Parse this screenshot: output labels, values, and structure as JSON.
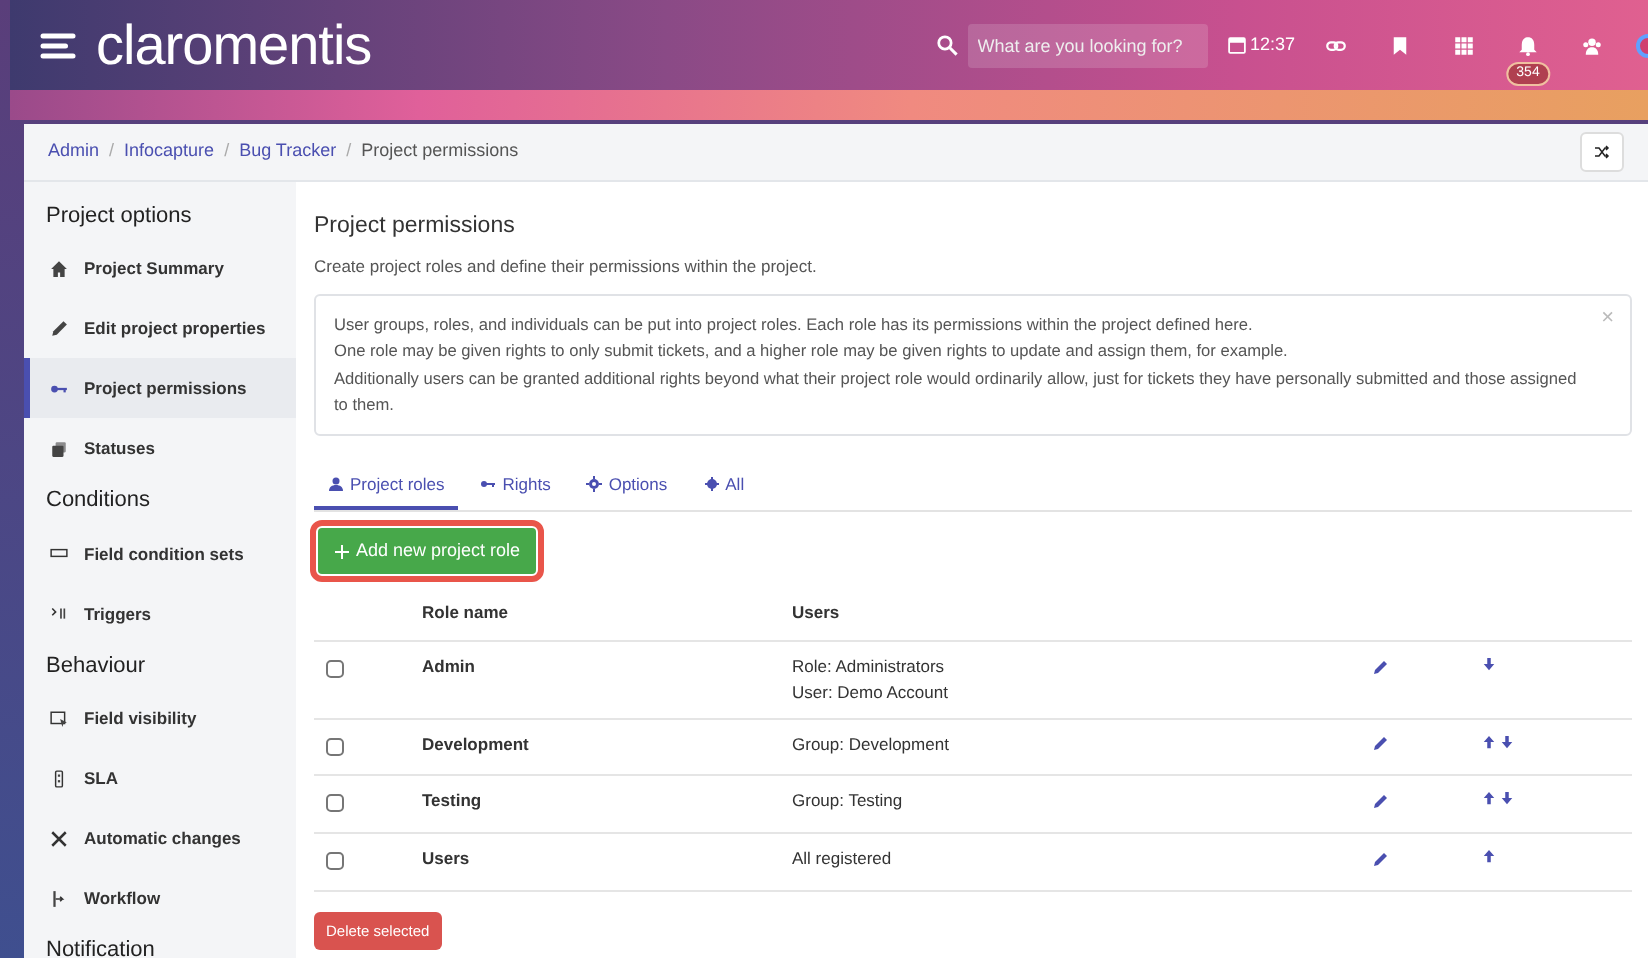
{
  "header": {
    "logo": "claromentis",
    "search": {
      "placeholder": "What are you looking for?"
    },
    "time": "12:37",
    "notification_count": "354"
  },
  "breadcrumb": [
    {
      "kind": "link",
      "label": "Admin"
    },
    {
      "kind": "separator",
      "label": "/"
    },
    {
      "kind": "link",
      "label": "Infocapture"
    },
    {
      "kind": "separator",
      "label": "/"
    },
    {
      "kind": "link",
      "label": "Bug Tracker"
    },
    {
      "kind": "separator",
      "label": "/"
    },
    {
      "kind": "current",
      "label": "Project permissions"
    }
  ],
  "sidebar": {
    "items": [
      {
        "kind": "heading",
        "label": "Project options"
      },
      {
        "kind": "item",
        "label": "Project Summary",
        "selected": false
      },
      {
        "kind": "item",
        "label": "Edit project properties",
        "selected": false
      },
      {
        "kind": "item",
        "label": "Project permissions",
        "selected": true
      },
      {
        "kind": "item",
        "label": "Statuses",
        "selected": false
      },
      {
        "kind": "heading",
        "label": "Conditions"
      },
      {
        "kind": "item",
        "label": "Field condition sets",
        "selected": false
      },
      {
        "kind": "item",
        "label": "Triggers",
        "selected": false
      },
      {
        "kind": "heading",
        "label": "Behaviour"
      },
      {
        "kind": "item",
        "label": "Field visibility",
        "selected": false
      },
      {
        "kind": "item",
        "label": "SLA",
        "selected": false
      },
      {
        "kind": "item",
        "label": "Automatic changes",
        "selected": false
      },
      {
        "kind": "item",
        "label": "Workflow",
        "selected": false
      },
      {
        "kind": "heading",
        "label": "Notification"
      }
    ]
  },
  "page": {
    "title": "Project permissions",
    "subtitle": "Create project roles and define their permissions within the project.",
    "info_lines": [
      "User groups, roles, and individuals can be put into project roles. Each role has its permissions within the project defined here.",
      "One role may be given rights to only submit tickets, and a higher role may be given rights to update and assign them, for example.",
      "Additionally users can be granted additional rights beyond what their project role would ordinarily allow, just for tickets they have personally submitted and those assigned to them."
    ],
    "info_close": "×",
    "tabs": [
      {
        "label": "Project roles",
        "selected": true
      },
      {
        "label": "Rights",
        "selected": false
      },
      {
        "label": "Options",
        "selected": false
      },
      {
        "label": "All",
        "selected": false
      }
    ],
    "add_button": {
      "label": "Add new project role",
      "highlighted": true
    },
    "table": {
      "columns": [
        "Role name",
        "Users"
      ],
      "rows": [
        {
          "checked": false,
          "name": "Admin",
          "users": [
            "Role: Administrators",
            "User: Demo Account"
          ],
          "move_up": false,
          "move_down": true
        },
        {
          "checked": false,
          "name": "Development",
          "users": [
            "Group: Development"
          ],
          "move_up": true,
          "move_down": true
        },
        {
          "checked": false,
          "name": "Testing",
          "users": [
            "Group: Testing"
          ],
          "move_up": true,
          "move_down": true
        },
        {
          "checked": false,
          "name": "Users",
          "users": [
            "All registered"
          ],
          "move_up": true,
          "move_down": false
        }
      ]
    },
    "delete_button": "Delete selected"
  }
}
